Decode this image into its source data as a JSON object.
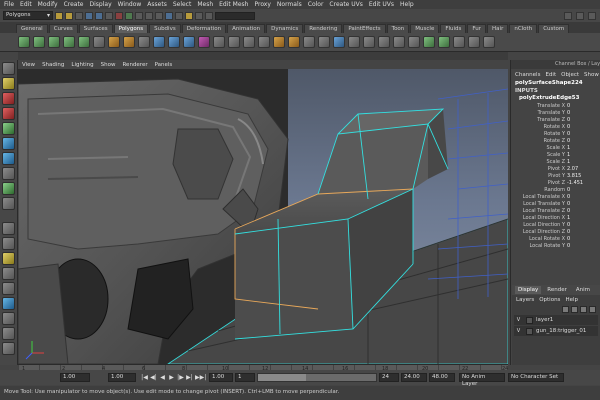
{
  "menubar": [
    "File",
    "Edit",
    "Modify",
    "Create",
    "Display",
    "Window",
    "Assets",
    "Select",
    "Mesh",
    "Edit Mesh",
    "Proxy",
    "Normals",
    "Color",
    "Create UVs",
    "Edit UVs",
    "Help"
  ],
  "status": {
    "mode": "Polygons"
  },
  "shelf_tabs": [
    "General",
    "Curves",
    "Surfaces",
    "Polygons",
    "Subdivs",
    "Deformation",
    "Animation",
    "Dynamics",
    "Rendering",
    "PaintEffects",
    "Toon",
    "Muscle",
    "Fluids",
    "Fur",
    "Hair",
    "nCloth",
    "Custom"
  ],
  "shelf_active_tab": "Polygons",
  "panel_menu": [
    "View",
    "Shading",
    "Lighting",
    "Show",
    "Renderer",
    "Panels"
  ],
  "channel_box": {
    "title": "Channel Box / Layer Editor",
    "tabs": [
      "Channels",
      "Edit",
      "Object",
      "Show"
    ],
    "object": "polySurfaceShape224",
    "inputs_label": "INPUTS",
    "node": "polyExtrudeEdge53",
    "attributes": [
      {
        "name": "Translate X",
        "value": "0"
      },
      {
        "name": "Translate Y",
        "value": "0"
      },
      {
        "name": "Translate Z",
        "value": "0"
      },
      {
        "name": "Rotate X",
        "value": "0"
      },
      {
        "name": "Rotate Y",
        "value": "0"
      },
      {
        "name": "Rotate Z",
        "value": "0"
      },
      {
        "name": "Scale X",
        "value": "1"
      },
      {
        "name": "Scale Y",
        "value": "1"
      },
      {
        "name": "Scale Z",
        "value": "1"
      },
      {
        "name": "Pivot X",
        "value": "2.07"
      },
      {
        "name": "Pivot Y",
        "value": "3.815"
      },
      {
        "name": "Pivot Z",
        "value": "-1.451"
      },
      {
        "name": "Random",
        "value": "0"
      },
      {
        "name": "Local Translate X",
        "value": "0"
      },
      {
        "name": "Local Translate Y",
        "value": "0"
      },
      {
        "name": "Local Translate Z",
        "value": "0"
      },
      {
        "name": "Local Direction X",
        "value": "1"
      },
      {
        "name": "Local Direction Y",
        "value": "0"
      },
      {
        "name": "Local Direction Z",
        "value": "0"
      },
      {
        "name": "Local Rotate X",
        "value": "0"
      },
      {
        "name": "Local Rotate Y",
        "value": "0"
      }
    ]
  },
  "layer_editor": {
    "tabs": [
      "Display",
      "Render",
      "Anim"
    ],
    "active_tab": "Display",
    "menu": [
      "Layers",
      "Options",
      "Help"
    ],
    "layers": [
      {
        "vis": "V",
        "name": "layer1"
      },
      {
        "vis": "V",
        "name": "gun_18:trigger_01"
      }
    ]
  },
  "time_slider": {
    "labels": [
      "1",
      "2",
      "4",
      "6",
      "8",
      "10",
      "12",
      "14",
      "16",
      "18",
      "20",
      "22",
      "24"
    ],
    "current_frame": "1.00"
  },
  "range_bar": {
    "start_time": "1.00",
    "start_frame": "1.00",
    "range_start": "1",
    "range_end": "24",
    "end_frame": "24.00",
    "end_time": "48.00",
    "anim_layer": "No Anim Layer",
    "char_set": "No Character Set",
    "playback_buttons": [
      "|◀",
      "◀|",
      "◀",
      "▶",
      "|▶",
      "▶|",
      "▶▶|"
    ]
  },
  "help_line": "Move Tool: Use manipulator to move object(s). Use edit mode to change pivot (INSERT). Ctrl+LMB to move perpendicular.",
  "colors": {
    "wireframe": "#33e0e0",
    "selected": "#e8a85a",
    "viewport_top": "#4f5868",
    "viewport_bottom": "#8a95a8"
  }
}
